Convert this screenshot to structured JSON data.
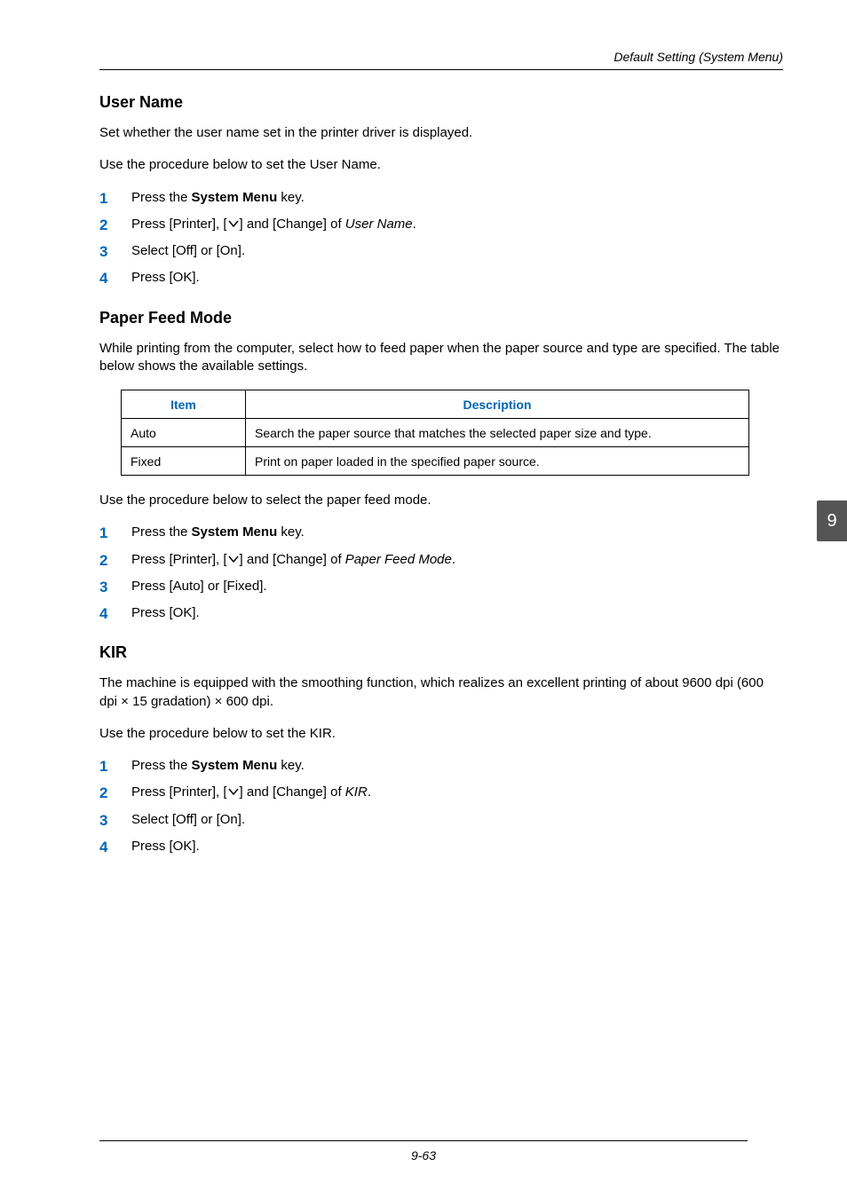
{
  "running_head": "Default Setting (System Menu)",
  "tab": "9",
  "sections": [
    {
      "heading": "User Name",
      "paras": [
        "Set whether the user name set in the printer driver is displayed.",
        "Use the procedure below to set the User Name."
      ],
      "steps": [
        "Press the <strong>System Menu</strong> key.",
        "Press [Printer], [@CHEV@] and [Change] of <em>User Name</em>.",
        "Select [Off] or [On].",
        "Press [OK]."
      ]
    },
    {
      "heading": "Paper Feed Mode",
      "paras": [
        "While printing from the computer, select how to feed paper when the paper source and type are specified. The table below shows the available settings."
      ],
      "table": {
        "headers": [
          "Item",
          "Description"
        ],
        "rows": [
          [
            "Auto",
            "Search the paper source that matches the selected paper size and type."
          ],
          [
            "Fixed",
            "Print on paper loaded in the specified paper source."
          ]
        ]
      },
      "paras_after": [
        "Use the procedure below to select the paper feed mode."
      ],
      "steps": [
        "Press the <strong>System Menu</strong> key.",
        "Press [Printer], [@CHEV@] and [Change] of <em>Paper Feed Mode</em>.",
        "Press [Auto] or [Fixed].",
        "Press [OK]."
      ]
    },
    {
      "heading": "KIR",
      "paras": [
        "The machine is equipped with the smoothing function, which realizes an excellent printing of about 9600 dpi (600 dpi × 15 gradation) × 600 dpi.",
        "Use the procedure below to set the KIR."
      ],
      "steps": [
        "Press the <strong>System Menu</strong> key.",
        "Press [Printer], [@CHEV@] and [Change] of <em>KIR</em>.",
        "Select [Off] or [On].",
        "Press [OK]."
      ]
    }
  ],
  "page_number": "9-63",
  "chev_svg": "<svg class='chev' viewBox='0 0 14 10' xmlns='http://www.w3.org/2000/svg'><polyline points='2,2 7,8 12,2' fill='none' stroke='#000' stroke-width='1.5'/></svg>"
}
